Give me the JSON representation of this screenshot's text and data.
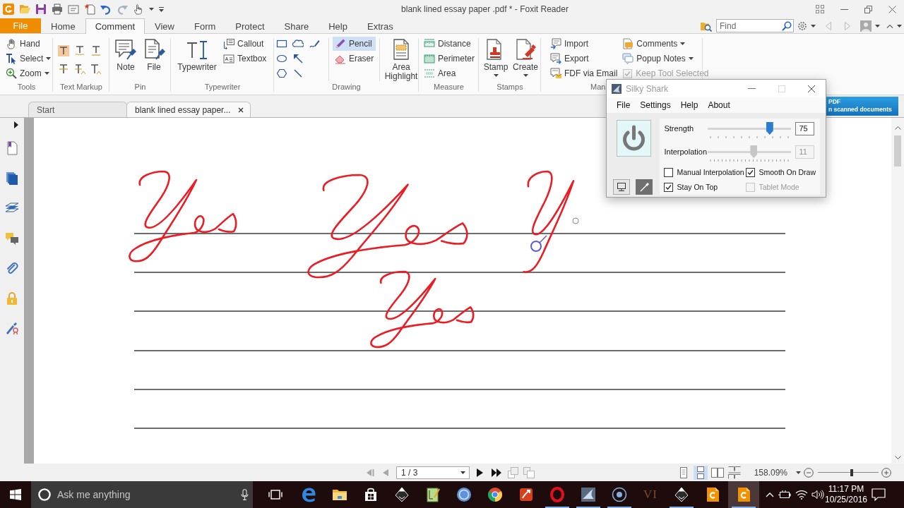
{
  "window": {
    "title": "blank lined essay paper .pdf * - Foxit Reader"
  },
  "ribbon_tabs": [
    {
      "label": "File",
      "kind": "menu",
      "selected": false
    },
    {
      "label": "Home",
      "kind": "tab",
      "selected": false
    },
    {
      "label": "Comment",
      "kind": "tab",
      "selected": true
    },
    {
      "label": "View",
      "kind": "tab",
      "selected": false
    },
    {
      "label": "Form",
      "kind": "tab",
      "selected": false
    },
    {
      "label": "Protect",
      "kind": "tab",
      "selected": false
    },
    {
      "label": "Share",
      "kind": "tab",
      "selected": false
    },
    {
      "label": "Help",
      "kind": "tab",
      "selected": false
    },
    {
      "label": "Extras",
      "kind": "tab",
      "selected": false
    }
  ],
  "find": {
    "placeholder": "Find"
  },
  "ribbon": [
    {
      "kind": "tools",
      "label": "Tools",
      "items": [
        {
          "label": "Hand",
          "dropdown": false
        },
        {
          "label": "Select",
          "dropdown": true
        },
        {
          "label": "Zoom",
          "dropdown": true
        }
      ]
    },
    {
      "kind": "markup",
      "label": "Text Markup"
    },
    {
      "kind": "pin",
      "label": "Pin",
      "items": [
        {
          "label": "Note"
        },
        {
          "label": "File"
        }
      ]
    },
    {
      "kind": "typewriter",
      "label": "Typewriter",
      "items": [
        {
          "label": "Typewriter",
          "kind": "large"
        },
        {
          "label": "Callout",
          "kind": "small"
        },
        {
          "label": "Textbox",
          "kind": "small"
        }
      ]
    },
    {
      "kind": "drawing",
      "label": "Drawing",
      "items": [
        {
          "label": "Pencil",
          "kind": "small",
          "selected": true
        },
        {
          "label": "Eraser",
          "kind": "small",
          "selected": false
        },
        {
          "label": "Area Highlight",
          "kind": "large",
          "selected": false
        }
      ]
    },
    {
      "kind": "measure",
      "label": "Measure",
      "items": [
        {
          "label": "Distance"
        },
        {
          "label": "Perimeter"
        },
        {
          "label": "Area"
        }
      ]
    },
    {
      "kind": "stamps",
      "label": "Stamps",
      "items": [
        {
          "label": "Stamp"
        },
        {
          "label": "Create"
        }
      ]
    },
    {
      "kind": "manage",
      "label": "Man",
      "items": [
        {
          "label": "Import"
        },
        {
          "label": "Export"
        },
        {
          "label": "FDF via Email"
        }
      ],
      "menus": [
        {
          "label": "Comments"
        },
        {
          "label": "Popup Notes"
        }
      ],
      "option": {
        "label": "Keep Tool Selected",
        "checked": true,
        "disabled": true
      }
    }
  ],
  "doc_tabs": [
    {
      "label": "Start",
      "selected": false
    },
    {
      "label": "blank lined essay paper...",
      "selected": true
    }
  ],
  "banner": {
    "lines": [
      "PDF",
      "n scanned documents"
    ]
  },
  "status_bar": {
    "page": "1 / 3",
    "view_modes": [
      {
        "selected": false
      },
      {
        "selected": true
      },
      {
        "selected": false
      },
      {
        "selected": false
      }
    ],
    "zoom": {
      "value": "158.09%",
      "level": 0.56
    }
  },
  "silky_shark": {
    "title": "Silky Shark",
    "menu": [
      "File",
      "Settings",
      "Help",
      "About"
    ],
    "sliders": [
      {
        "label": "Strength",
        "value": "75",
        "level": 0.74,
        "disabled": false
      },
      {
        "label": "Interpolation",
        "value": "11",
        "level": 0.55,
        "disabled": true
      }
    ],
    "checkboxes": [
      {
        "label": "Manual Interpolation",
        "checked": false,
        "disabled": false
      },
      {
        "label": "Smooth On Draw",
        "checked": true,
        "disabled": false
      },
      {
        "label": "Stay On Top",
        "checked": true,
        "disabled": false
      },
      {
        "label": "Tablet Mode",
        "checked": false,
        "disabled": true
      }
    ]
  },
  "taskbar": {
    "search": {
      "placeholder": "Ask me anything"
    },
    "apps": [
      {
        "running": false,
        "selected": false
      },
      {
        "running": false,
        "selected": false
      },
      {
        "running": false,
        "selected": false
      },
      {
        "running": false,
        "selected": false
      },
      {
        "running": false,
        "selected": false
      },
      {
        "running": false,
        "selected": false
      },
      {
        "running": false,
        "selected": false
      },
      {
        "running": false,
        "selected": false
      },
      {
        "running": true,
        "selected": false
      },
      {
        "running": true,
        "selected": false
      },
      {
        "running": true,
        "selected": false
      },
      {
        "label": "VI",
        "running": false,
        "selected": false
      },
      {
        "running": true,
        "selected": false
      },
      {
        "running": false,
        "selected": false
      },
      {
        "running": true,
        "selected": true
      }
    ],
    "clock": {
      "time": "11:17 PM",
      "date": "10/25/2016"
    }
  }
}
